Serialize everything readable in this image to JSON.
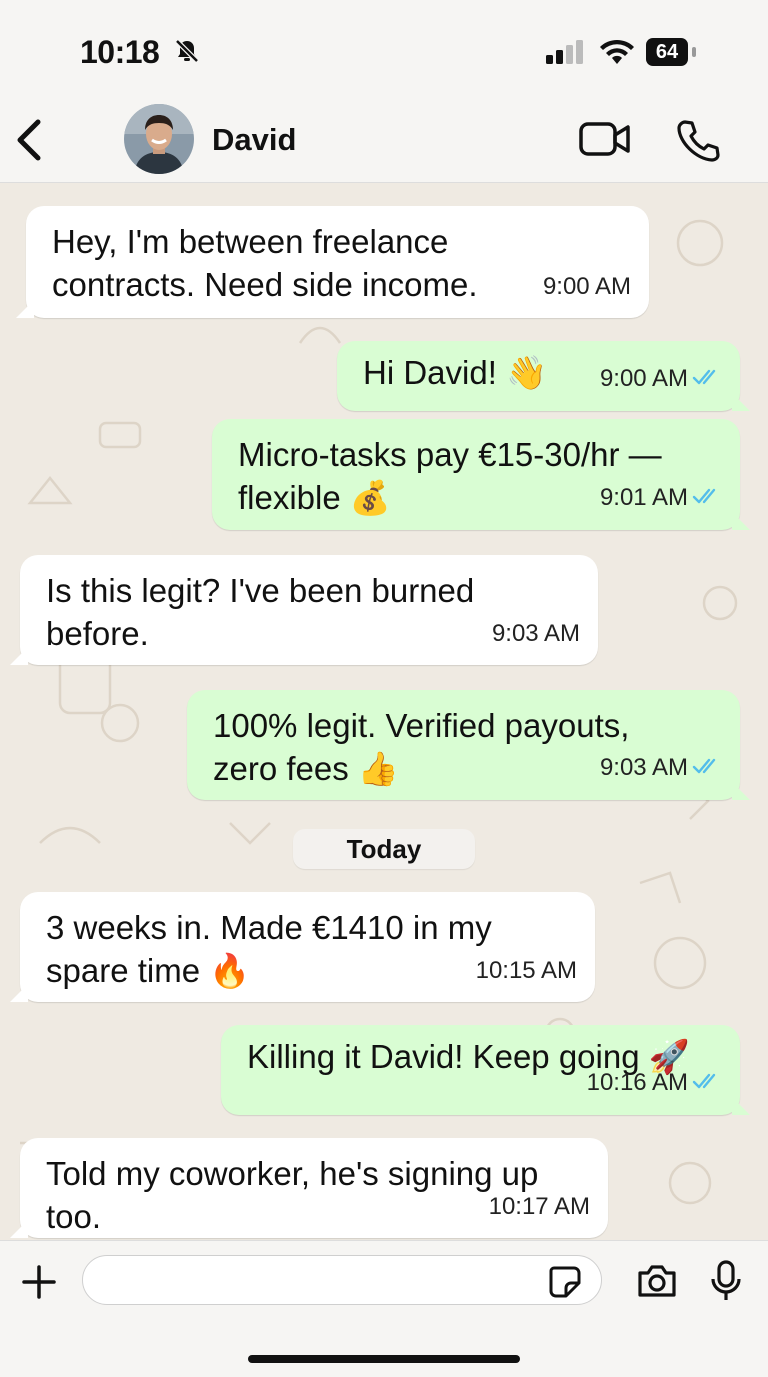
{
  "status_bar": {
    "time": "10:18",
    "battery": "64"
  },
  "header": {
    "contact_name": "David"
  },
  "date_divider": "Today",
  "messages": [
    {
      "direction": "in",
      "lines": [
        "Hey, I'm between freelance",
        "contracts. Need side income."
      ],
      "time": "9:00 AM"
    },
    {
      "direction": "out",
      "lines": [
        "Hi David! 👋"
      ],
      "time": "9:00 AM",
      "read": true
    },
    {
      "direction": "out",
      "lines": [
        "Micro-tasks pay €15-30/hr —",
        "flexible 💰"
      ],
      "time": "9:01 AM",
      "read": true
    },
    {
      "direction": "in",
      "lines": [
        "Is this legit? I've been burned",
        "before."
      ],
      "time": "9:03 AM"
    },
    {
      "direction": "out",
      "lines": [
        "100% legit. Verified payouts,",
        "zero fees 👍"
      ],
      "time": "9:03 AM",
      "read": true
    },
    {
      "direction": "in",
      "lines": [
        "3 weeks in. Made €1410 in my",
        "spare time 🔥"
      ],
      "time": "10:15 AM"
    },
    {
      "direction": "out",
      "lines": [
        "Killing it David! Keep going 🚀"
      ],
      "time": "10:16 AM",
      "read": true
    },
    {
      "direction": "in",
      "lines": [
        "Told my coworker, he's signing up",
        "too."
      ],
      "time": "10:17 AM"
    }
  ],
  "input": {
    "value": "",
    "placeholder": ""
  },
  "colors": {
    "incoming_bubble": "#ffffff",
    "outgoing_bubble": "#d9fdd3",
    "read_ticks": "#53bdeb",
    "chat_background": "#efeae2"
  },
  "icons": [
    "back-icon",
    "video-call-icon",
    "phone-icon",
    "plus-icon",
    "sticker-icon",
    "camera-icon",
    "mic-icon",
    "silent-bell-icon",
    "signal-icon",
    "wifi-icon",
    "battery-icon"
  ]
}
